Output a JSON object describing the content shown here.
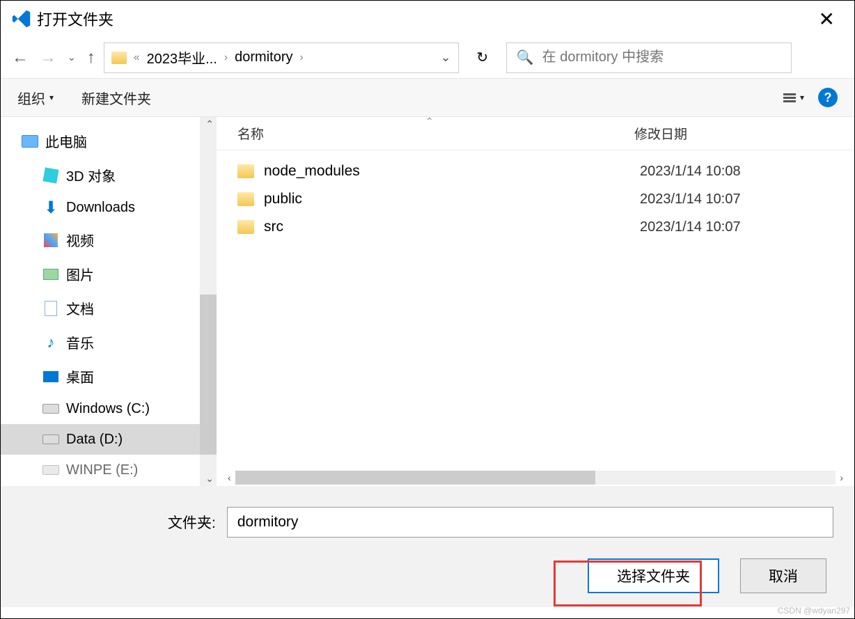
{
  "title": "打开文件夹",
  "breadcrumb": {
    "items": [
      "2023毕业...",
      "dormitory"
    ],
    "separator": "›",
    "prefix": "«"
  },
  "search": {
    "placeholder": "在 dormitory 中搜索"
  },
  "toolbar": {
    "organize": "组织",
    "new_folder": "新建文件夹"
  },
  "columns": {
    "name": "名称",
    "date": "修改日期"
  },
  "sidebar": {
    "root": "此电脑",
    "items": [
      {
        "label": "3D 对象"
      },
      {
        "label": "Downloads"
      },
      {
        "label": "视频"
      },
      {
        "label": "图片"
      },
      {
        "label": "文档"
      },
      {
        "label": "音乐"
      },
      {
        "label": "桌面"
      },
      {
        "label": "Windows (C:)"
      },
      {
        "label": "Data (D:)"
      },
      {
        "label": "WINPE (E:)"
      }
    ]
  },
  "files": [
    {
      "name": "node_modules",
      "date": "2023/1/14 10:08"
    },
    {
      "name": "public",
      "date": "2023/1/14 10:07"
    },
    {
      "name": "src",
      "date": "2023/1/14 10:07"
    }
  ],
  "footer": {
    "folder_label": "文件夹:",
    "folder_value": "dormitory",
    "select_button": "选择文件夹",
    "cancel_button": "取消"
  },
  "watermark": "CSDN @wdyan297"
}
